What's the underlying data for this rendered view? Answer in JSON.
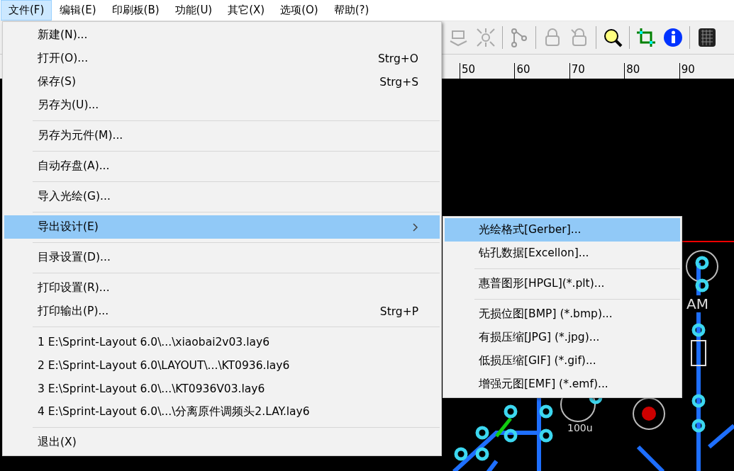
{
  "menubar": [
    {
      "label": "文件(F)",
      "selected": true
    },
    {
      "label": "编辑(E)",
      "selected": false
    },
    {
      "label": "印刷板(B)",
      "selected": false
    },
    {
      "label": "功能(U)",
      "selected": false
    },
    {
      "label": "其它(X)",
      "selected": false
    },
    {
      "label": "选项(O)",
      "selected": false
    },
    {
      "label": "帮助(?)",
      "selected": false
    }
  ],
  "ruler": {
    "labels": [
      "50",
      "60",
      "70",
      "80",
      "90"
    ]
  },
  "pcb": {
    "labels": [
      "AM",
      "100u"
    ]
  },
  "file_menu": [
    {
      "kind": "item",
      "label": "新建(N)...",
      "selected": false
    },
    {
      "kind": "item",
      "label": "打开(O)...",
      "shortcut": "Strg+O",
      "selected": false
    },
    {
      "kind": "item",
      "label": "保存(S)",
      "shortcut": "Strg+S",
      "selected": false
    },
    {
      "kind": "item",
      "label": "另存为(U)...",
      "selected": false
    },
    {
      "kind": "separator"
    },
    {
      "kind": "item",
      "label": "另存为元件(M)...",
      "selected": false
    },
    {
      "kind": "separator"
    },
    {
      "kind": "item",
      "label": "自动存盘(A)...",
      "selected": false
    },
    {
      "kind": "separator"
    },
    {
      "kind": "item",
      "label": "导入光绘(G)...",
      "selected": false
    },
    {
      "kind": "separator"
    },
    {
      "kind": "submenu",
      "label": "导出设计(E)",
      "selected": true
    },
    {
      "kind": "separator"
    },
    {
      "kind": "item",
      "label": "目录设置(D)...",
      "selected": false
    },
    {
      "kind": "separator"
    },
    {
      "kind": "item",
      "label": "打印设置(R)...",
      "selected": false
    },
    {
      "kind": "item",
      "label": "打印输出(P)...",
      "shortcut": "Strg+P",
      "selected": false
    },
    {
      "kind": "separator"
    },
    {
      "kind": "item",
      "label": "1 E:\\Sprint-Layout 6.0\\...\\xiaobai2v03.lay6",
      "selected": false
    },
    {
      "kind": "item",
      "label": "2 E:\\Sprint-Layout 6.0\\LAYOUT\\...\\KT0936.lay6",
      "selected": false
    },
    {
      "kind": "item",
      "label": "3 E:\\Sprint-Layout 6.0\\...\\KT0936V03.lay6",
      "selected": false
    },
    {
      "kind": "item",
      "label": "4 E:\\Sprint-Layout 6.0\\...\\分离原件调频头2.LAY.lay6",
      "selected": false
    },
    {
      "kind": "separator"
    },
    {
      "kind": "item",
      "label": "退出(X)",
      "selected": false
    }
  ],
  "export_submenu": [
    {
      "kind": "item",
      "label": "光绘格式[Gerber]...",
      "selected": true
    },
    {
      "kind": "item",
      "label": "钻孔数据[Excellon]...",
      "selected": false
    },
    {
      "kind": "separator"
    },
    {
      "kind": "item",
      "label": "惠普图形[HPGL](*.plt)...",
      "selected": false
    },
    {
      "kind": "separator"
    },
    {
      "kind": "item",
      "label": "无损位图[BMP] (*.bmp)...",
      "selected": false
    },
    {
      "kind": "item",
      "label": "有损压缩[JPG] (*.jpg)...",
      "selected": false
    },
    {
      "kind": "item",
      "label": "低损压缩[GIF] (*.gif)...",
      "selected": false
    },
    {
      "kind": "item",
      "label": "增强元图[EMF] (*.emf)...",
      "selected": false
    }
  ]
}
